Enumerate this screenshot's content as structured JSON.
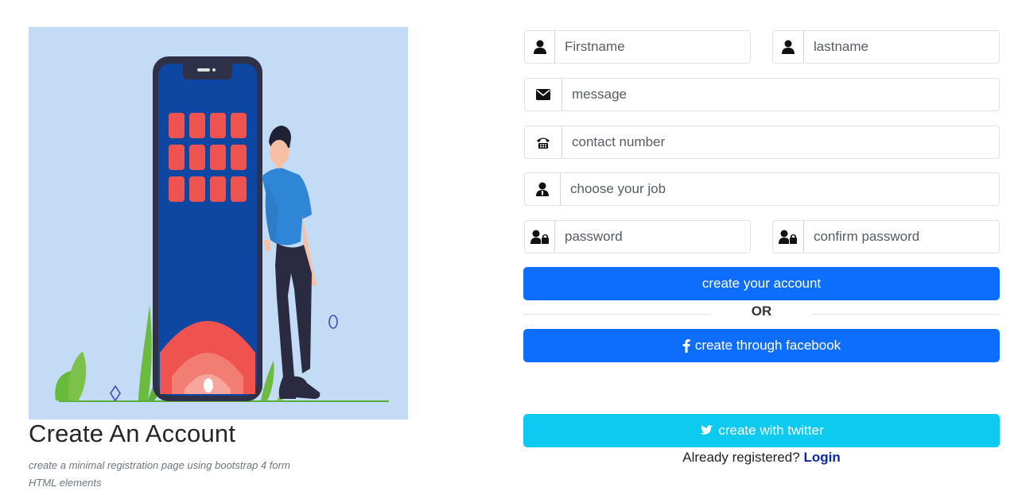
{
  "hero": {
    "title": "Create An Account",
    "subtitle": "create a minimal registration page using bootstrap 4 form HTML elements"
  },
  "form": {
    "firstname": {
      "placeholder": "Firstname",
      "icon": "user-icon"
    },
    "lastname": {
      "placeholder": "lastname",
      "icon": "user-icon"
    },
    "message": {
      "placeholder": "message",
      "icon": "envelope-icon"
    },
    "contact": {
      "placeholder": "contact number",
      "icon": "phone-icon"
    },
    "job": {
      "placeholder": "choose your job",
      "icon": "user-tie-icon"
    },
    "password": {
      "placeholder": "password",
      "icon": "user-lock-icon"
    },
    "confirm": {
      "placeholder": "confirm password",
      "icon": "user-lock-icon"
    },
    "create_label": "create your account",
    "or_label": "OR",
    "facebook_label": "create through facebook",
    "twitter_label": "create with twitter",
    "already_label": "Already registered?",
    "login_label": "Login"
  },
  "colors": {
    "primary": "#0d6efd",
    "info": "#0dcaf0",
    "illustration_bg": "#c3dbf5",
    "phone_screen": "#0d47a1",
    "app_tiles": "#ef5350"
  }
}
